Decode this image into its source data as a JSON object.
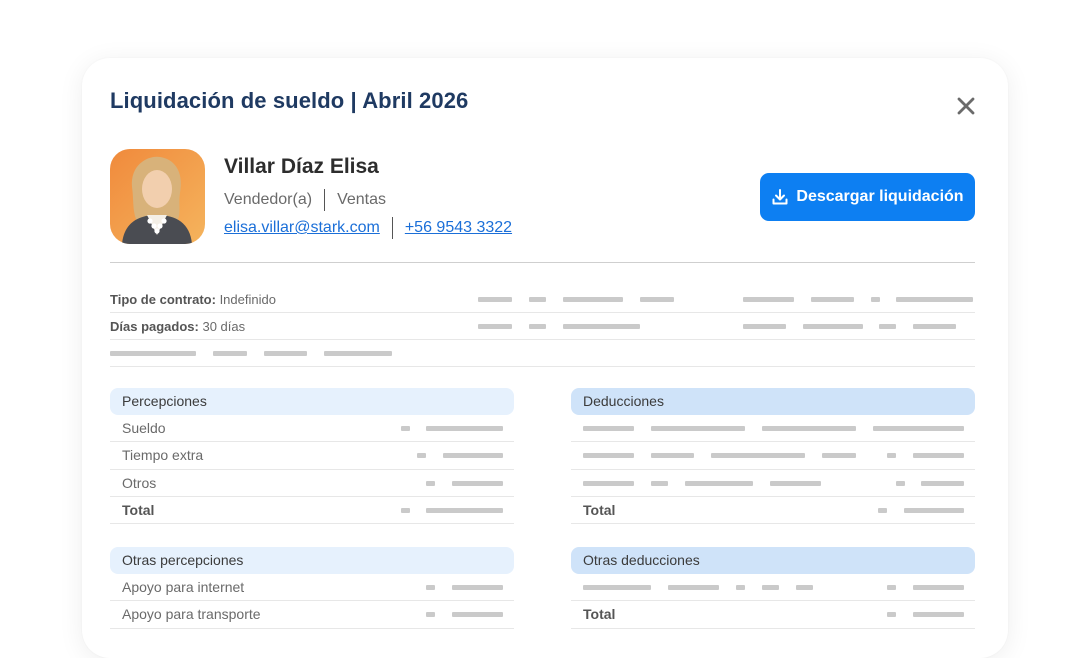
{
  "header": {
    "title": "Liquidación de sueldo | Abril 2026"
  },
  "employee": {
    "name": "Villar Díaz Elisa",
    "role": "Vendedor(a)",
    "department": "Ventas",
    "email": "elisa.villar@stark.com",
    "phone": "+56 9543 3322"
  },
  "actions": {
    "download_label": "Descargar liquidación"
  },
  "contract_info": {
    "contract_type_label": "Tipo de contrato:",
    "contract_type_value": "Indefinido",
    "days_paid_label": "Días pagados:",
    "days_paid_value": "30 días"
  },
  "perceptions": {
    "title": "Percepciones",
    "rows": [
      "Sueldo",
      "Tiempo extra",
      "Otros"
    ],
    "total_label": "Total"
  },
  "deductions": {
    "title": "Deducciones",
    "total_label": "Total"
  },
  "other_perceptions": {
    "title": "Otras percepciones",
    "rows": [
      "Apoyo para internet",
      "Apoyo para transporte"
    ]
  },
  "other_deductions": {
    "title": "Otras deducciones",
    "total_label": "Total"
  },
  "colors": {
    "title": "#1f3a62",
    "accent": "#0d7ff2",
    "link": "#1b6fd8",
    "section_header_light": "#e6f1fd",
    "section_header_dark": "#cfe3f9"
  },
  "icons": {
    "close": "close-icon",
    "download": "download-icon"
  }
}
